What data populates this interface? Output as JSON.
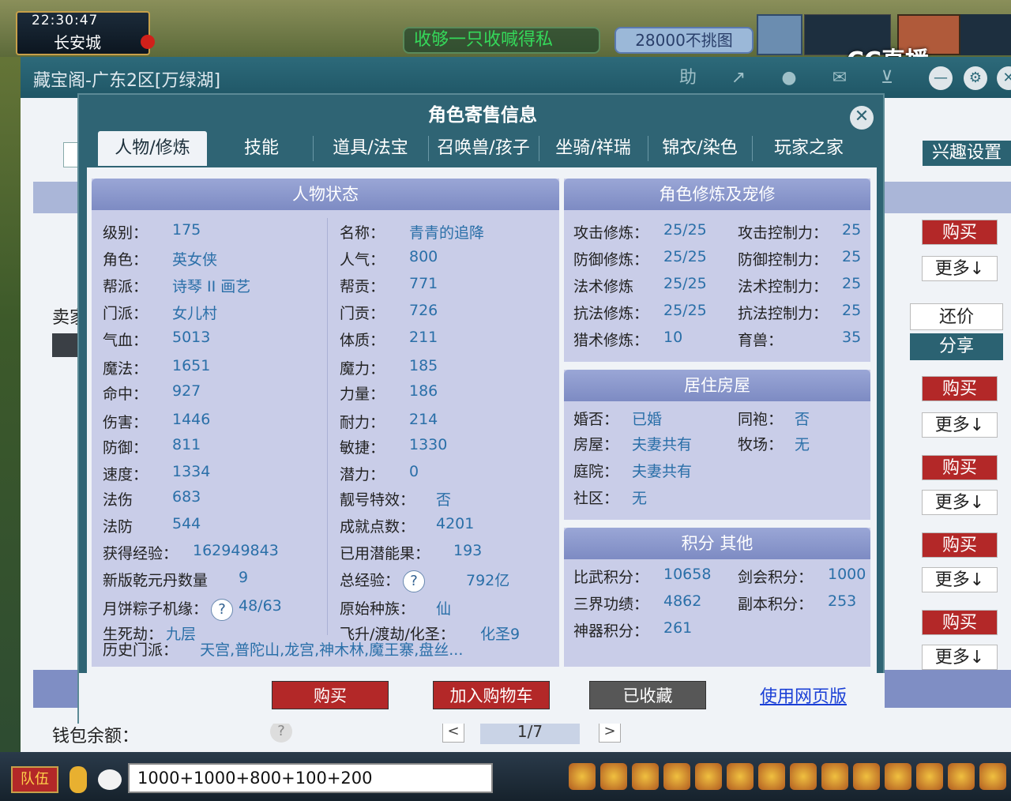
{
  "hud": {
    "time": "22:30:47",
    "location": "长安城",
    "banner_left": "收够一只收喊得私",
    "banner_right": "28000不挑图",
    "watermark": "CC直播"
  },
  "outer": {
    "title": "藏宝阁-广东2区[万绿湖]",
    "title_buttons": [
      "助"
    ],
    "interest_btn": "兴趣设置",
    "seller_label": "卖家",
    "haggle": "还价",
    "share": "分享",
    "buy": "购买",
    "more": "更多↓",
    "wallet_label": "钱包余额：",
    "wallet_help": "?",
    "pager": "1/7",
    "pager_prev": "<",
    "pager_next": ">"
  },
  "modal": {
    "title": "角色寄售信息",
    "close": "✕",
    "tabs": [
      "人物/修炼",
      "技能",
      "道具/法宝",
      "召唤兽/孩子",
      "坐骑/祥瑞",
      "锦衣/染色",
      "玩家之家"
    ],
    "left_panel": {
      "title": "人物状态",
      "left_col": [
        {
          "label": "级别：",
          "value": "175"
        },
        {
          "label": "角色：",
          "value": "英女侠"
        },
        {
          "label": "帮派：",
          "value": "诗琴 II 画艺"
        },
        {
          "label": "门派：",
          "value": "女儿村"
        },
        {
          "label": "气血：",
          "value": "5013"
        },
        {
          "label": "魔法：",
          "value": "1651"
        },
        {
          "label": "命中：",
          "value": "927"
        },
        {
          "label": "伤害：",
          "value": "1446"
        },
        {
          "label": "防御：",
          "value": "811"
        },
        {
          "label": "速度：",
          "value": "1334"
        },
        {
          "label": "法伤",
          "value": "683"
        },
        {
          "label": "法防",
          "value": "544"
        },
        {
          "label": "获得经验：",
          "value": "162949843"
        },
        {
          "label": "新版乾元丹数量",
          "value": "9"
        },
        {
          "label": "月饼粽子机缘：",
          "value": "48/63",
          "help": "?"
        },
        {
          "label": "生死劫：",
          "value": "九层"
        }
      ],
      "right_col": [
        {
          "label": "名称：",
          "value": "青青的追降"
        },
        {
          "label": "人气：",
          "value": "800"
        },
        {
          "label": "帮贡：",
          "value": "771"
        },
        {
          "label": "门贡：",
          "value": "726"
        },
        {
          "label": "体质：",
          "value": "211"
        },
        {
          "label": "魔力：",
          "value": "185"
        },
        {
          "label": "力量：",
          "value": "186"
        },
        {
          "label": "耐力：",
          "value": "214"
        },
        {
          "label": "敏捷：",
          "value": "1330"
        },
        {
          "label": "潜力：",
          "value": "0"
        },
        {
          "label": "靓号特效：",
          "value": "否"
        },
        {
          "label": "成就点数：",
          "value": "4201"
        },
        {
          "label": "已用潜能果：",
          "value": "193"
        },
        {
          "label": "总经验：",
          "value": "792亿",
          "help": "?"
        },
        {
          "label": "原始种族：",
          "value": "仙"
        },
        {
          "label": "飞升/渡劫/化圣：",
          "value": "化圣9"
        }
      ],
      "history": {
        "label": "历史门派：",
        "value": "天宫,普陀山,龙宫,神木林,魔王寨,盘丝..."
      }
    },
    "cultivation_panel": {
      "title": "角色修炼及宠修",
      "rows": [
        {
          "l1": "攻击修炼：",
          "v1": "25/25",
          "l2": "攻击控制力：",
          "v2": "25"
        },
        {
          "l1": "防御修炼：",
          "v1": "25/25",
          "l2": "防御控制力：",
          "v2": "25"
        },
        {
          "l1": "法术修炼",
          "v1": "25/25",
          "l2": "法术控制力：",
          "v2": "25"
        },
        {
          "l1": "抗法修炼：",
          "v1": "25/25",
          "l2": "抗法控制力：",
          "v2": "25"
        },
        {
          "l1": "猎术修炼：",
          "v1": "10",
          "l2": "育兽：",
          "v2": "35"
        }
      ]
    },
    "house_panel": {
      "title": "居住房屋",
      "rows": [
        {
          "l1": "婚否：",
          "v1": "已婚",
          "l2": "同袍：",
          "v2": "否"
        },
        {
          "l1": "房屋：",
          "v1": "夫妻共有",
          "l2": "牧场：",
          "v2": "无"
        },
        {
          "l1": "庭院：",
          "v1": "夫妻共有",
          "l2": "",
          "v2": ""
        },
        {
          "l1": "社区：",
          "v1": "无",
          "l2": "",
          "v2": ""
        }
      ]
    },
    "score_panel": {
      "title": "积分 其他",
      "rows": [
        {
          "l1": "比武积分：",
          "v1": "10658",
          "l2": "剑会积分：",
          "v2": "1000"
        },
        {
          "l1": "三界功绩：",
          "v1": "4862",
          "l2": "副本积分：",
          "v2": "253"
        },
        {
          "l1": "神器积分：",
          "v1": "261",
          "l2": "",
          "v2": ""
        }
      ]
    },
    "footer": {
      "buy": "购买",
      "cart": "加入购物车",
      "favorited": "已收藏",
      "web": "使用网页版"
    }
  },
  "bottom": {
    "team": "队伍",
    "chat_value": "1000+1000+800+100+200"
  }
}
